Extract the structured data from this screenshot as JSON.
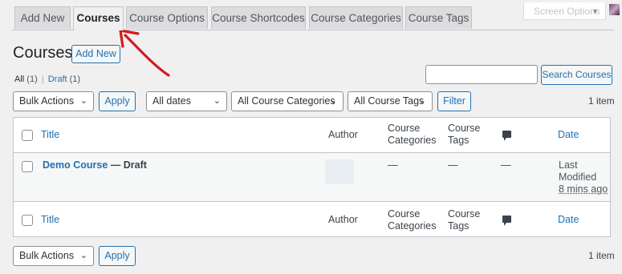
{
  "tabs": [
    "Add New",
    "Courses",
    "Course Options",
    "Course Shortcodes",
    "Course Categories",
    "Course Tags"
  ],
  "screen_options": "Screen Options",
  "page_title": "Courses",
  "add_new": "Add New",
  "filters": {
    "all": "All",
    "all_count": "(1)",
    "separator": "|",
    "draft": "Draft",
    "draft_count": "(1)"
  },
  "search": {
    "value": "",
    "button": "Search Courses"
  },
  "top_nav": {
    "bulk_actions": "Bulk Actions",
    "apply": "Apply",
    "dates": "All dates",
    "categories": "All Course Categories",
    "tags": "All Course Tags",
    "filter": "Filter",
    "count": "1 item"
  },
  "columns": {
    "title": "Title",
    "author": "Author",
    "categories_1": "Course",
    "categories_2": "Categories",
    "tags_1": "Course",
    "tags_2": "Tags",
    "date": "Date"
  },
  "row": {
    "title": "Demo Course",
    "state": " — Draft",
    "categories": "—",
    "tags": "—",
    "comments": "—",
    "date_1": "Last",
    "date_2": "Modified",
    "date_3": "8 mins ago"
  },
  "bottom_nav": {
    "bulk_actions": "Bulk Actions",
    "apply": "Apply",
    "count": "1 item"
  },
  "colors": {
    "link": "#2271b1",
    "annotation_arrow": "#d41a1a"
  }
}
